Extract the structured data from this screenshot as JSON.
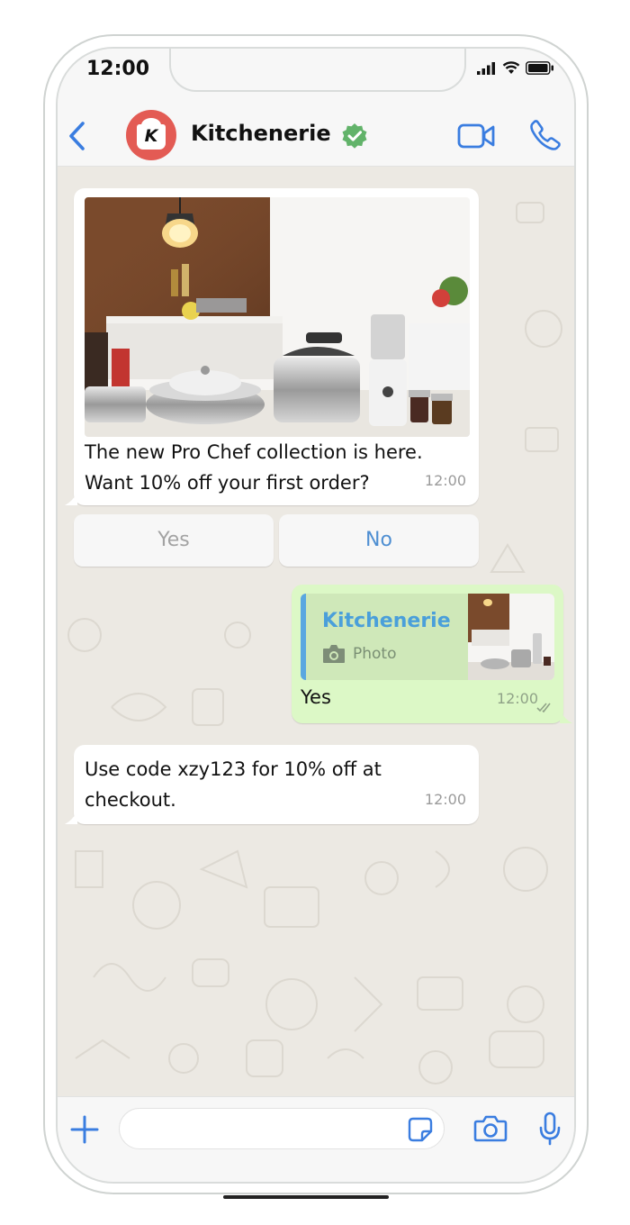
{
  "status": {
    "time": "12:00"
  },
  "header": {
    "contact_name": "Kitchenerie",
    "avatar_letter": "K"
  },
  "messages": {
    "incoming_1": {
      "text": "The new Pro Chef collection is here. Want 10% off your first order?",
      "time": "12:00"
    },
    "quick_replies": [
      "Yes",
      "No"
    ],
    "outgoing_1": {
      "quoted_name": "Kitchenerie",
      "quoted_type": "Photo",
      "text": "Yes",
      "time": "12:00"
    },
    "incoming_2": {
      "text": "Use code xzy123 for 10% off at checkout.",
      "time": "12:00"
    }
  },
  "colors": {
    "accent": "#3a7de0",
    "verified": "#62b36a",
    "outgoing_bubble": "#dcf8c6",
    "avatar": "#e35b54"
  },
  "icons": [
    "back-chevron-icon",
    "verified-badge-icon",
    "video-call-icon",
    "phone-call-icon",
    "plus-icon",
    "sticker-icon",
    "camera-icon",
    "microphone-icon"
  ]
}
